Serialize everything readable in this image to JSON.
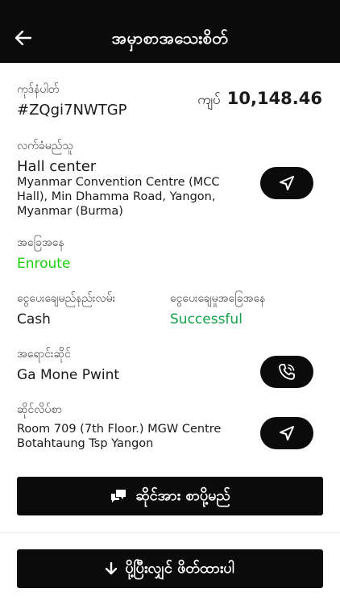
{
  "header": {
    "title": "အမှာစာအသေးစိတ်"
  },
  "order": {
    "id_label": "ကုဒ်နံပါတ်",
    "id": "#ZQgi7NWTGP",
    "currency": "ကျပ်",
    "amount": "10,148.46"
  },
  "receiver": {
    "label": "လက်ခံမည်သူ",
    "name": "Hall center",
    "address": "Myanmar Convention Centre (MCC Hall), Min Dhamma Road, Yangon, Myanmar (Burma)"
  },
  "status": {
    "label": "အခြေအနေ",
    "value": "Enroute"
  },
  "payment": {
    "method_label": "ငွေပေးချေမည်နည်းလမ်း",
    "method": "Cash",
    "status_label": "ငွေပေးချေမှုအခြေအနေ",
    "status": "Successful"
  },
  "vendor": {
    "label": "အရောင်းဆိုင်",
    "name": "Ga Mone Pwint"
  },
  "shop_address": {
    "label": "ဆိုင်လိပ်စာ",
    "address": "Room 709 (7th Floor.) MGW Centre Botahtaung Tsp Yangon"
  },
  "buttons": {
    "chat_label": "ဆိုင်အား စာပို့မည်",
    "download_label": "ပို့ပြီးလျှင် ဖိတ်ထားပါ"
  },
  "colors": {
    "enroute": "#19d10d",
    "successful": "#15a04a",
    "dark": "#0b0b0b"
  },
  "icons": [
    "back-arrow-icon",
    "navigate-icon",
    "phone-icon",
    "chat-icon",
    "download-arrow-icon"
  ]
}
